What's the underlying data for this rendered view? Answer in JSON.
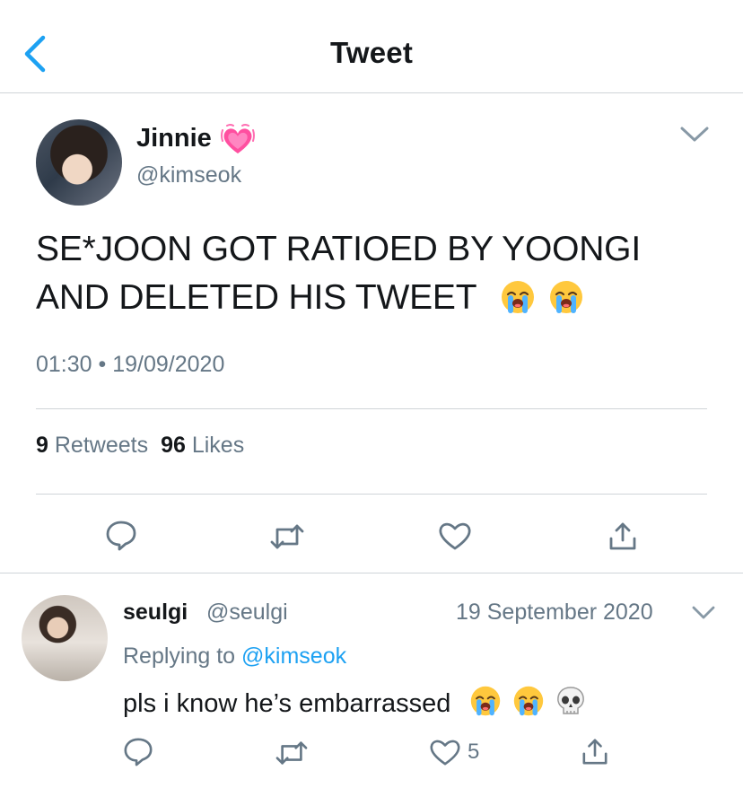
{
  "nav": {
    "title": "Tweet",
    "back_icon": "chevron-left-icon",
    "accent": "#1da1f2"
  },
  "tweet": {
    "display_name": "Jinnie",
    "name_emoji": "growing-heart-emoji",
    "handle": "@kimseok",
    "text_lines": [
      "SE*JOON GOT RATIOED BY YOONGI",
      "AND DELETED HIS TWEET"
    ],
    "text_emojis": [
      "loudly-crying-face",
      "loudly-crying-face"
    ],
    "time": "01:30",
    "separator": "•",
    "date": "19/09/2020",
    "retweets": {
      "count": "9",
      "label": "Retweets"
    },
    "likes": {
      "count": "96",
      "label": "Likes"
    },
    "actions": [
      "reply-icon",
      "retweet-icon",
      "like-icon",
      "share-icon"
    ]
  },
  "reply": {
    "display_name": "seulgi",
    "handle": "@seulgi",
    "date": "19 September 2020",
    "replying_prefix": "Replying to",
    "replying_handle": "@kimseok",
    "text": "pls i know he’s embarrassed",
    "emojis": [
      "loudly-crying-face",
      "loudly-crying-face",
      "skull"
    ],
    "like_count": "5"
  },
  "colors": {
    "text": "#14171a",
    "secondary": "#657786",
    "divider": "#cfd4d8",
    "link": "#1da1f2",
    "icon_gray": "#657786"
  }
}
